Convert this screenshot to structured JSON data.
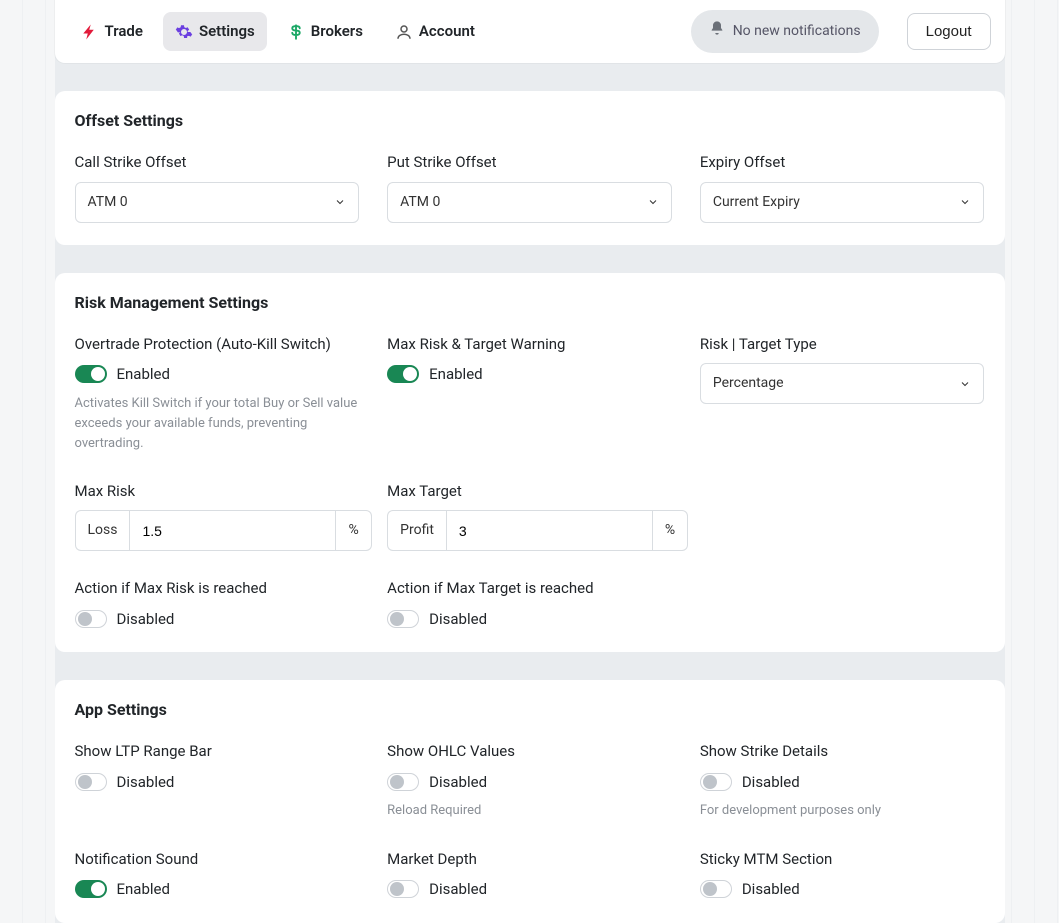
{
  "nav": {
    "tabs": [
      {
        "id": "trade",
        "label": "Trade",
        "iconColor": "#e21a3a"
      },
      {
        "id": "settings",
        "label": "Settings",
        "iconColor": "#6b3fe0",
        "active": true
      },
      {
        "id": "brokers",
        "label": "Brokers",
        "iconColor": "#1ba866"
      },
      {
        "id": "account",
        "label": "Account",
        "iconColor": "#555"
      }
    ],
    "notifications": "No new notifications",
    "logout": "Logout"
  },
  "offset": {
    "title": "Offset Settings",
    "call": {
      "label": "Call Strike Offset",
      "value": "ATM 0"
    },
    "put": {
      "label": "Put Strike Offset",
      "value": "ATM 0"
    },
    "expiry": {
      "label": "Expiry Offset",
      "value": "Current Expiry"
    }
  },
  "risk": {
    "title": "Risk Management Settings",
    "overtrade": {
      "label": "Overtrade Protection (Auto-Kill Switch)",
      "state": "Enabled",
      "help": "Activates Kill Switch if your total Buy or Sell value exceeds your available funds, preventing overtrading."
    },
    "warning": {
      "label": "Max Risk & Target Warning",
      "state": "Enabled"
    },
    "type": {
      "label": "Risk | Target Type",
      "value": "Percentage"
    },
    "maxRisk": {
      "label": "Max Risk",
      "prefix": "Loss",
      "value": "1.5",
      "suffix": "%"
    },
    "maxTarget": {
      "label": "Max Target",
      "prefix": "Profit",
      "value": "3",
      "suffix": "%"
    },
    "actionRisk": {
      "label": "Action if Max Risk is reached",
      "state": "Disabled"
    },
    "actionTarget": {
      "label": "Action if Max Target is reached",
      "state": "Disabled"
    }
  },
  "app": {
    "title": "App Settings",
    "ltp": {
      "label": "Show LTP Range Bar",
      "state": "Disabled"
    },
    "ohlc": {
      "label": "Show OHLC Values",
      "state": "Disabled",
      "help": "Reload Required"
    },
    "strike": {
      "label": "Show Strike Details",
      "state": "Disabled",
      "help": "For development purposes only"
    },
    "sound": {
      "label": "Notification Sound",
      "state": "Enabled"
    },
    "depth": {
      "label": "Market Depth",
      "state": "Disabled"
    },
    "sticky": {
      "label": "Sticky MTM Section",
      "state": "Disabled"
    }
  }
}
